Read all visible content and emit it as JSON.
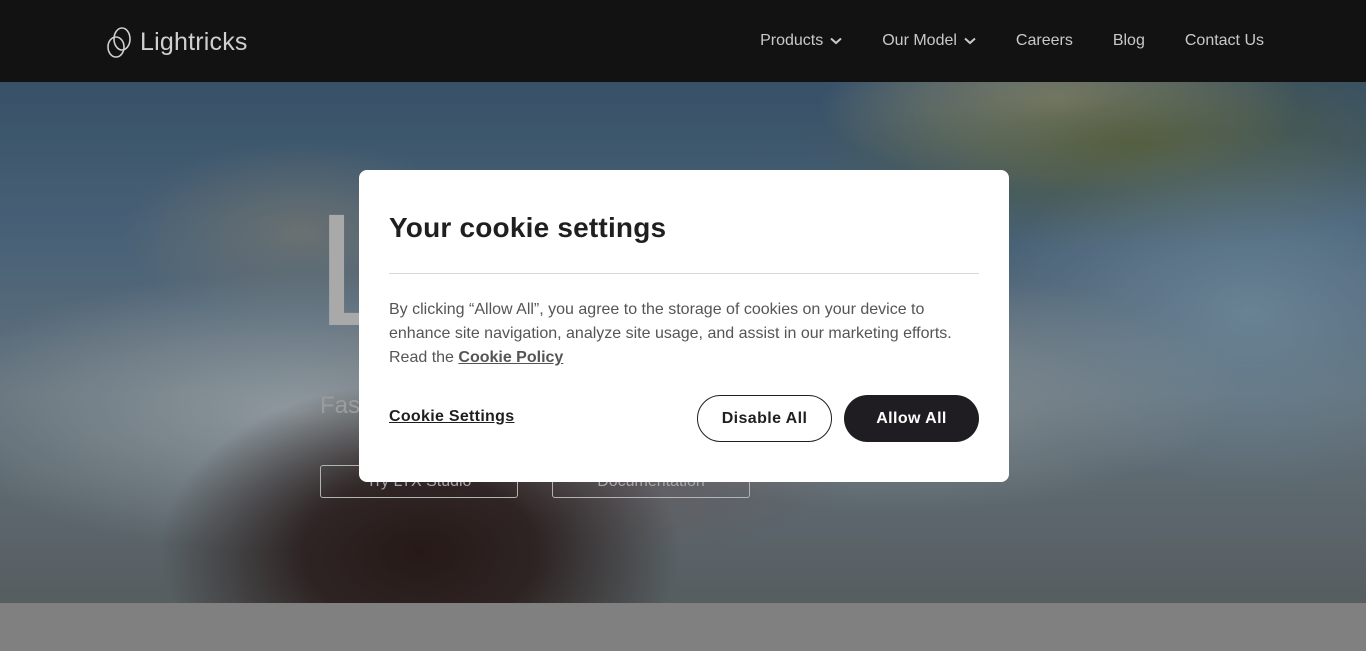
{
  "header": {
    "brand": "Lightricks",
    "nav": [
      {
        "label": "Products",
        "icon": "chevron-down-icon"
      },
      {
        "label": "Our Model",
        "icon": "chevron-down-icon"
      },
      {
        "label": "Careers"
      },
      {
        "label": "Blog"
      },
      {
        "label": "Contact Us"
      }
    ]
  },
  "hero": {
    "title_fragment": "L",
    "subtitle_fragment": "Fas",
    "buttons": [
      "Try LTX Studio",
      "Documentation"
    ]
  },
  "cookie_modal": {
    "title": "Your cookie settings",
    "body": "By clicking “Allow All”, you agree to the storage of cookies on your device to enhance site navigation, analyze site usage, and assist in our marketing efforts. Read the",
    "policy_link": "Cookie Policy",
    "settings_link": "Cookie Settings",
    "disable_button": "Disable All",
    "allow_button": "Allow All"
  },
  "colors": {
    "header_bg": "#121212",
    "modal_bg": "#ffffff",
    "primary_button": "#1f1d21",
    "text_dark": "#1f1f1f"
  }
}
